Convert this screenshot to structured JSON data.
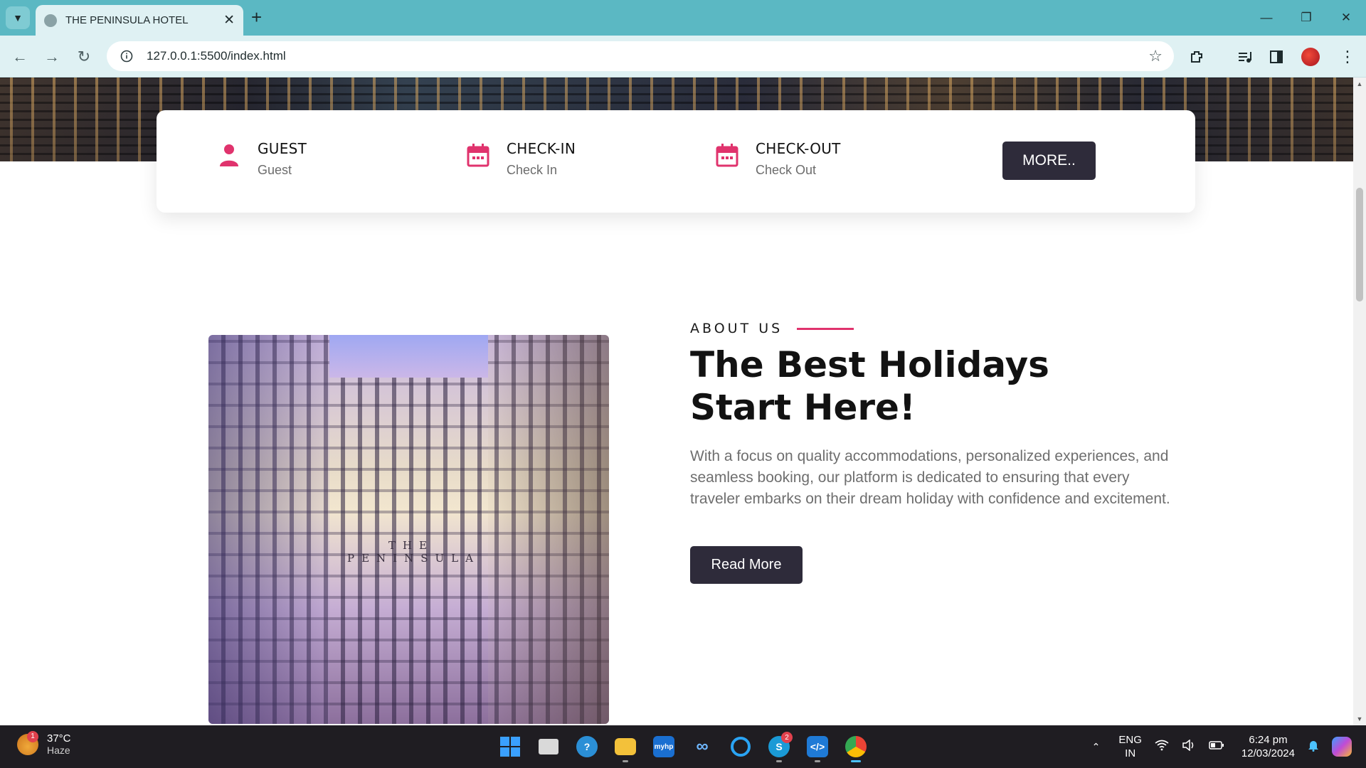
{
  "browser": {
    "tab_title": "THE PENINSULA HOTEL",
    "url": "127.0.0.1:5500/index.html"
  },
  "booking": {
    "guest_label": "GUEST",
    "guest_value": "Guest",
    "checkin_label": "CHECK-IN",
    "checkin_value": "Check In",
    "checkout_label": "CHECK-OUT",
    "checkout_value": "Check Out",
    "more_button": "MORE.."
  },
  "about": {
    "kicker": "ABOUT US",
    "heading": "The Best Holidays Start Here!",
    "body": "With a focus on quality accommodations, personalized experiences, and seamless booking, our platform is dedicated to ensuring that every traveler embarks on their dream holiday with confidence and excitement.",
    "read_more": "Read More",
    "image_sign": "THE PENINSULA"
  },
  "colors": {
    "accent": "#e0336d",
    "button": "#2e2b3a",
    "chrome": "#5bb8c3"
  },
  "taskbar": {
    "weather_temp": "37°C",
    "weather_condition": "Haze",
    "weather_badge": "1",
    "skype_badge": "2",
    "language": "ENG",
    "region": "IN",
    "time": "6:24 pm",
    "date": "12/03/2024"
  }
}
